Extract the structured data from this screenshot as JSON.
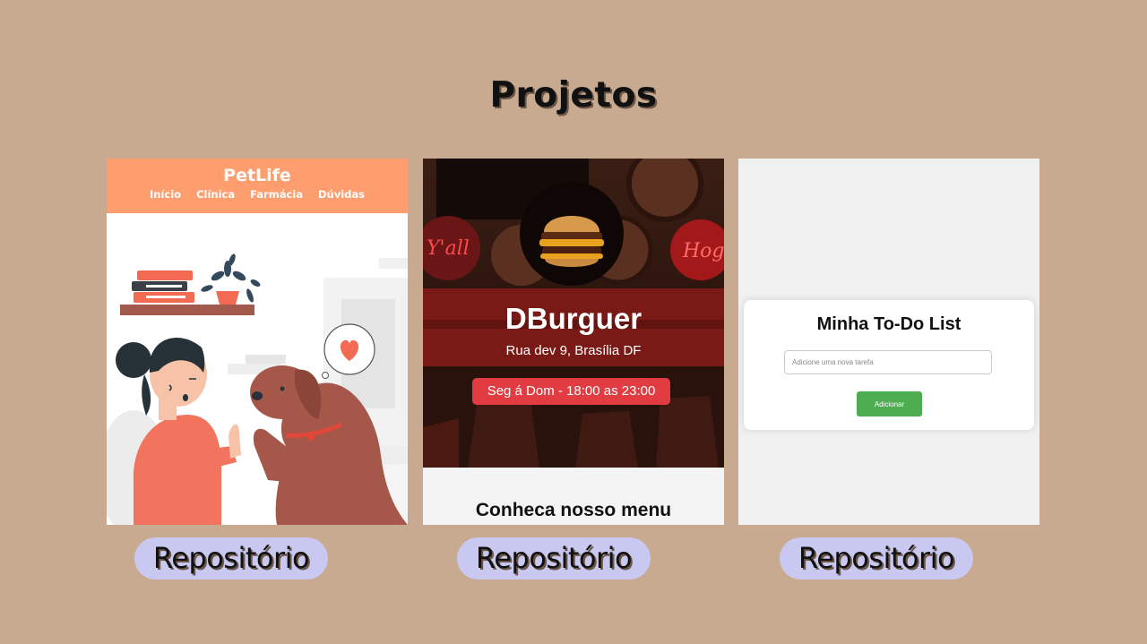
{
  "page": {
    "title": "Projetos"
  },
  "colors": {
    "background": "#c8aa91",
    "pill": "#c9c8f0",
    "petlife_header": "#fe9e6f",
    "burger_badge": "#e23c43",
    "todo_button": "#4cae50"
  },
  "projects": [
    {
      "name": "PetLife",
      "nav": [
        "Início",
        "Clínica",
        "Farmácia",
        "Dúvidas"
      ],
      "link_label": "Repositório"
    },
    {
      "name": "DBurguer",
      "address": "Rua dev 9, Brasília DF",
      "hours": "Seg á Dom - 18:00 as 23:00",
      "menu_title": "Conheca nosso menu",
      "neon_signs": [
        "Y'all",
        "Hog"
      ],
      "link_label": "Repositório"
    },
    {
      "name": "Minha To-Do List",
      "input_placeholder": "Adicione uma nova tarefa",
      "button_label": "Adicionar",
      "link_label": "Repositório"
    }
  ]
}
